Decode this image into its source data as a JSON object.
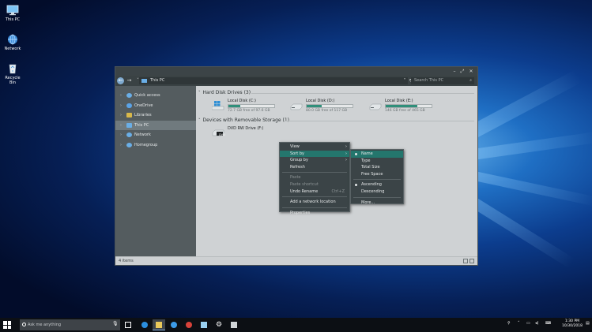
{
  "desktop": {
    "icons": [
      {
        "label": "This PC",
        "icon": "this-pc-icon"
      },
      {
        "label": "Network",
        "icon": "network-icon"
      },
      {
        "label": "Recycle Bin",
        "icon": "recycle-bin-icon"
      }
    ]
  },
  "window": {
    "controls": {
      "minimize": "–",
      "restore": "⤢",
      "close": "✕"
    },
    "address": {
      "path": "This PC",
      "search_placeholder": "Search This PC"
    },
    "sidebar": {
      "items": [
        {
          "label": "Quick access",
          "icon": "star-icon",
          "color": "#6aaee6"
        },
        {
          "label": "OneDrive",
          "icon": "cloud-icon",
          "color": "#5ba3e6"
        },
        {
          "label": "Libraries",
          "icon": "library-icon",
          "color": "#d9b84a"
        },
        {
          "label": "This PC",
          "icon": "pc-icon",
          "color": "#6aaee6"
        },
        {
          "label": "Network",
          "icon": "network-icon",
          "color": "#6aaee6"
        },
        {
          "label": "Homegroup",
          "icon": "homegroup-icon",
          "color": "#6aaee6"
        }
      ]
    },
    "groups": {
      "hdd": "Hard Disk Drives (3)",
      "removable": "Devices with Removable Storage (1)"
    },
    "drives": [
      {
        "name": "Local Disk (C:)",
        "free": "72.7 GB free of 97.6 GB",
        "used_fraction": 0.26
      },
      {
        "name": "Local Disk (D:)",
        "free": "80.0 GB free of 117 GB",
        "used_fraction": 0.32
      },
      {
        "name": "Local Disk (E:)",
        "free": "146 GB free of 465 GB",
        "used_fraction": 0.69
      }
    ],
    "dvd": {
      "name": "DVD RW Drive (F:)",
      "badge": "DVD"
    },
    "status": "4 items"
  },
  "context_menu": {
    "items": [
      "View",
      "Sort by",
      "Group by",
      "Refresh",
      "Paste",
      "Paste shortcut",
      "Undo Rename",
      "Add a network location",
      "Properties"
    ],
    "undo_shortcut": "Ctrl+Z"
  },
  "sort_submenu": {
    "items": [
      "Name",
      "Type",
      "Total Size",
      "Free Space",
      "Ascending",
      "Descending",
      "More..."
    ]
  },
  "taskbar": {
    "search_placeholder": "Ask me anything",
    "time": "1:30 PM",
    "date": "10/30/2018"
  }
}
